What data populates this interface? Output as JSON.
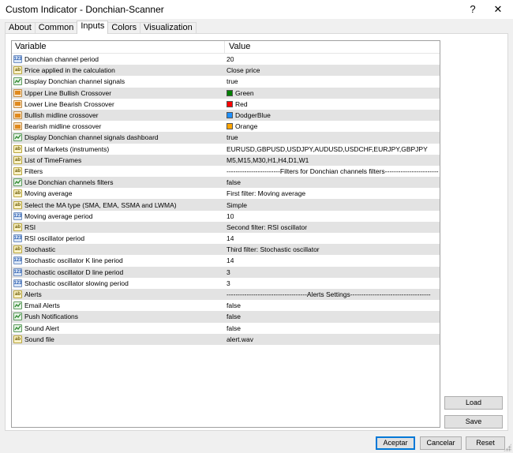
{
  "window": {
    "title": "Custom Indicator - Donchian-Scanner",
    "help_label": "?",
    "close_label": "✕"
  },
  "tabs": [
    {
      "label": "About"
    },
    {
      "label": "Common"
    },
    {
      "label": "Inputs"
    },
    {
      "label": "Colors"
    },
    {
      "label": "Visualization"
    }
  ],
  "active_tab": "Inputs",
  "grid": {
    "header": {
      "variable": "Variable",
      "value": "Value"
    },
    "rows": [
      {
        "type": "num",
        "variable": "Donchian channel period",
        "value": "20"
      },
      {
        "type": "str",
        "variable": "Price applied in the calculation",
        "value": "Close price"
      },
      {
        "type": "bool",
        "variable": "Display Donchian channel signals",
        "value": "true"
      },
      {
        "type": "color",
        "variable": "Upper Line Bullish Crossover",
        "value": "Green",
        "swatch": "#008000"
      },
      {
        "type": "color",
        "variable": "Lower Line Bearish Crossover",
        "value": "Red",
        "swatch": "#ff0000"
      },
      {
        "type": "color",
        "variable": "Bullish midline crossover",
        "value": "DodgerBlue",
        "swatch": "#1e90ff"
      },
      {
        "type": "color",
        "variable": "Bearish midline crossover",
        "value": "Orange",
        "swatch": "#ffa500"
      },
      {
        "type": "bool",
        "variable": "Display Donchian channel signals dashboard",
        "value": "true"
      },
      {
        "type": "str",
        "variable": "List of Markets (instruments)",
        "value": "EURUSD,GBPUSD,USDJPY,AUDUSD,USDCHF,EURJPY,GBPJPY"
      },
      {
        "type": "str",
        "variable": "List of TimeFrames",
        "value": "M5,M15,M30,H1,H4,D1,W1"
      },
      {
        "type": "str",
        "variable": "Filters",
        "value": "------------------------Filters for Donchian channels filters------------------------"
      },
      {
        "type": "bool",
        "variable": "Use Donchian channels filters",
        "value": "false"
      },
      {
        "type": "str",
        "variable": "Moving average",
        "value": "First filter: Moving average"
      },
      {
        "type": "str",
        "variable": "Select the MA type (SMA, EMA, SSMA and LWMA)",
        "value": "Simple"
      },
      {
        "type": "num",
        "variable": "Moving average period",
        "value": "10"
      },
      {
        "type": "str",
        "variable": "RSI",
        "value": "Second filter: RSI oscillator"
      },
      {
        "type": "num",
        "variable": "RSI oscillator period",
        "value": "14"
      },
      {
        "type": "str",
        "variable": "Stochastic",
        "value": "Third filter: Stochastic oscillator"
      },
      {
        "type": "num",
        "variable": "Stochastic oscillator K line period",
        "value": "14"
      },
      {
        "type": "num",
        "variable": "Stochastic oscillator D line period",
        "value": "3"
      },
      {
        "type": "num",
        "variable": "Stochastic oscillator slowing period",
        "value": "3"
      },
      {
        "type": "str",
        "variable": "Alerts",
        "value": "------------------------------------Alerts Settings------------------------------------"
      },
      {
        "type": "bool",
        "variable": "Email Alerts",
        "value": "false"
      },
      {
        "type": "bool",
        "variable": "Push Notifications",
        "value": "false"
      },
      {
        "type": "bool",
        "variable": "Sound Alert",
        "value": "false"
      },
      {
        "type": "str",
        "variable": "Sound file",
        "value": "alert.wav"
      }
    ]
  },
  "buttons": {
    "load": "Load",
    "save": "Save",
    "ok": "Aceptar",
    "cancel": "Cancelar",
    "reset": "Reset"
  },
  "icons": {
    "num": "numeric-parameter-icon",
    "str": "string-parameter-icon",
    "bool": "boolean-parameter-icon",
    "color": "color-parameter-icon"
  }
}
